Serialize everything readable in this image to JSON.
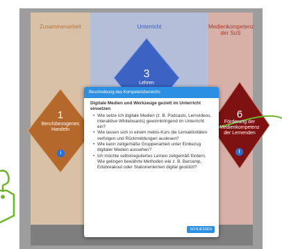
{
  "columns": {
    "left": {
      "title": "Zusammenarbeit"
    },
    "middle": {
      "title": "Unterricht"
    },
    "right": {
      "title": "Medienkompetenz der SuS"
    }
  },
  "diamonds": {
    "d1": {
      "number": "1",
      "label": "Berufsbezogenes Handeln",
      "color": "#b4682c"
    },
    "d3": {
      "number": "3",
      "label": "Lehren",
      "color": "#3c63c3"
    },
    "d6": {
      "number": "6",
      "label": "Förderung der Medienkompetenz der Lernenden",
      "color": "#7e1111"
    }
  },
  "info_glyph": "i",
  "modal": {
    "title": "Beschreibung des Kompetenzbereichs",
    "heading": "Digitale Medien und Werkzeuge gezielt im Unterricht einsetzen",
    "items": [
      "Wie setze ich digitale Medien (z. B. Podcasts, Lernvideos, interaktive Whiteboards) gewinnbringend im Unterricht ein?",
      "Wie lassen sich in einem mebis-Kurs die Lernaktivitäten verfolgen und Rückmeldungen auslesen?",
      "Wie kann zeitgemäße Gruppenarbeit unter Einbezug digitaler Medien aussehen?",
      "Ich möchte selbstreguliertes Lernen zeitgemäß fördern. Wie gelingen bewährte Methoden wie z. B. Barcamp, Edubreakout oder Stationenlernen digital gestützt?"
    ],
    "close_label": "SCHLIESSEN"
  },
  "colors": {
    "accent": "#2b8fe3",
    "arrow": "#6fb52c"
  }
}
